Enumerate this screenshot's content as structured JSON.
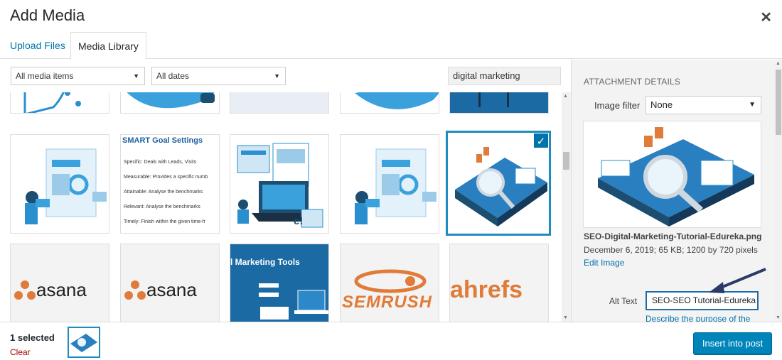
{
  "header": {
    "title": "Add Media",
    "close_icon": "close-icon"
  },
  "tabs": [
    {
      "label": "Upload Files"
    },
    {
      "label": "Media Library"
    }
  ],
  "toolbar": {
    "type_filter": "All media items",
    "date_filter": "All dates",
    "search_value": "digital marketing"
  },
  "grid": {
    "thumbnails": {
      "smart_goal_title": "SMART Goal Settings",
      "smart_lines": [
        "Specific: Deals with Leads, Visits",
        "Measurable: Provides a specific numb",
        "Attainable: Analyse the benchmarks",
        "Relevant: Analyse the benchmarks",
        "Timely: Finish within the given time-fr"
      ],
      "asana_1": "asana",
      "asana_2": "asana",
      "marketing_tools": "l Marketing Tools",
      "semrush": "SEMRUSH",
      "ahrefs": "ahrefs",
      "edureka_mark": "e!"
    },
    "selected_check": "✓"
  },
  "sidebar": {
    "heading": "ATTACHMENT DETAILS",
    "filter_label": "Image filter",
    "filter_value": "None",
    "filename": "SEO-Digital-Marketing-Tutorial-Edureka.png",
    "meta": "December 6, 2019; 65 KB; 1200 by 720 pixels",
    "edit_link": "Edit Image",
    "alt_label": "Alt Text",
    "alt_value": "SEO-SEO Tutorial-Edureka",
    "describe_link": "Describe the purpose of the"
  },
  "footer": {
    "selected_count": "1 selected",
    "clear_label": "Clear",
    "insert_label": "Insert into post"
  },
  "colors": {
    "accent": "#0073aa",
    "button": "#0085ba",
    "selected_border": "#1e8cbe",
    "clear": "#a00"
  }
}
